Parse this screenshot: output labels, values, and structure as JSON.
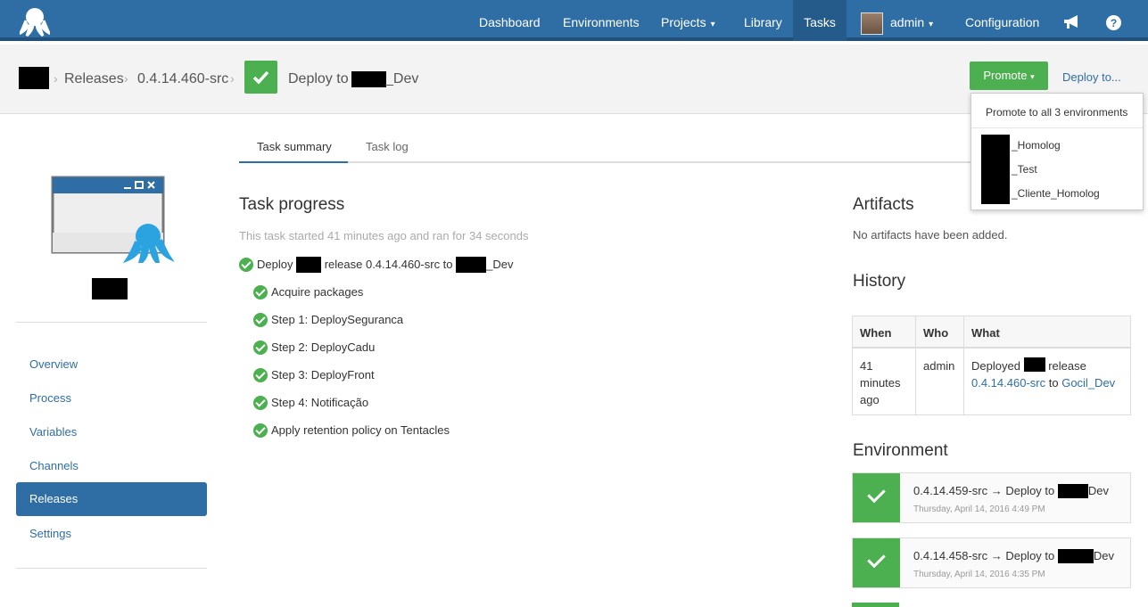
{
  "nav": {
    "dashboard": "Dashboard",
    "environments": "Environments",
    "projects": "Projects",
    "library": "Library",
    "tasks": "Tasks",
    "user": "admin",
    "configuration": "Configuration",
    "chevron": "▾",
    "announce_icon": "megaphone-icon",
    "help_icon": "help-icon"
  },
  "breadcrumb": {
    "releases": "Releases",
    "version": "0.4.14.460-src",
    "sep": "›",
    "deploy_prefix": "Deploy to",
    "deploy_suffix": "_Dev"
  },
  "actions": {
    "promote": "Promote",
    "deploy_to": "Deploy to..."
  },
  "promote_menu": {
    "all": "Promote to all 3 environments",
    "items": [
      "_Homolog",
      "_Test",
      "_Cliente_Homolog"
    ]
  },
  "sidebar": {
    "items": [
      "Overview",
      "Process",
      "Variables",
      "Channels",
      "Releases",
      "Settings"
    ],
    "active": "Releases"
  },
  "tabs": {
    "summary": "Task summary",
    "log": "Task log"
  },
  "task": {
    "heading": "Task progress",
    "started": "This task started 41 minutes ago and ran for 34 seconds",
    "main_a": "Deploy",
    "main_b": "release 0.4.14.460-src to",
    "main_c": "_Dev",
    "steps": [
      "Acquire packages",
      "Step 1: DeploySeguranca",
      "Step 2: DeployCadu",
      "Step 3: DeployFront",
      "Step 4: Notificação",
      "Apply retention policy on Tentacles"
    ]
  },
  "artifacts": {
    "heading": "Artifacts",
    "empty": "No artifacts have been added."
  },
  "history": {
    "heading": "History",
    "cols": [
      "When",
      "Who",
      "What"
    ],
    "when": [
      "41",
      "minutes",
      "ago"
    ],
    "who": "admin",
    "what_a": "Deployed",
    "what_b": "release",
    "what_version": "0.4.14.460-src",
    "what_to": "to",
    "what_env": "Gocil_Dev"
  },
  "environment": {
    "heading": "Environment",
    "cards": [
      {
        "a": "0.4.14.459-src → Deploy to",
        "b": "Dev",
        "date": "Thursday, April 14, 2016 4:49 PM"
      },
      {
        "a": "0.4.14.458-src → Deploy to",
        "b": "Dev",
        "date": "Thursday, April 14, 2016 4:35 PM"
      }
    ]
  },
  "colors": {
    "brand": "#2f6ea5",
    "success": "#4caf50"
  }
}
